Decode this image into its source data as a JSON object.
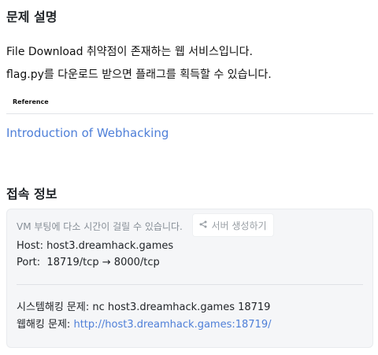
{
  "description": {
    "heading": "문제 설명",
    "line1": "File Download 취약점이 존재하는 웹 서비스입니다.",
    "line2": "flag.py를 다운로드 받으면 플래그를 획득할 수 있습니다.",
    "reference_label": "Reference",
    "reference_link": "Introduction of Webhacking"
  },
  "connection": {
    "heading": "접속 정보",
    "vm_note": "VM 부팅에 다소 시간이 걸릴 수 있습니다.",
    "server_button": "서버 생성하기",
    "host_label": "Host:",
    "host_value": "host3.dreamhack.games",
    "port_label": "Port:",
    "port_value": "18719/tcp → 8000/tcp",
    "system_label": "시스템해킹 문제:",
    "system_value": "nc host3.dreamhack.games 18719",
    "web_label": "웹해킹 문제:",
    "web_url": "http://host3.dreamhack.games:18719/"
  },
  "colors": {
    "link": "#4e7fd8",
    "box_bg": "#f5f6f8"
  }
}
